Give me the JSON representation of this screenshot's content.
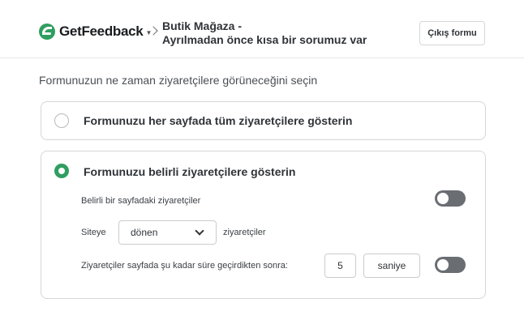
{
  "header": {
    "logo_text": "GetFeedback",
    "logo_caret": "▼",
    "breadcrumb_title": "Butik Mağaza -",
    "breadcrumb_subtitle": "Ayrılmadan önce kısa bir sorumuz var",
    "exit_button_label": "Çıkış formu"
  },
  "main": {
    "section_title": "Formunuzun ne zaman ziyaretçilere görüneceğini seçin",
    "option_all": {
      "label": "Formunuzu her sayfada tüm ziyaretçilere gösterin",
      "selected": false
    },
    "option_specific": {
      "label": "Formunuzu belirli ziyaretçilere gösterin",
      "selected": true,
      "page_visitors_label": "Belirli bir sayfadaki ziyaretçiler",
      "page_visitors_toggle": false,
      "site_prefix": "Siteye",
      "site_select_value": "dönen",
      "site_suffix": "ziyaretçiler",
      "time_label": "Ziyaretçiler sayfada şu kadar süre geçirdikten sonra:",
      "time_value": "5",
      "time_unit": "saniye",
      "time_toggle": false
    }
  },
  "colors": {
    "brand_green": "#2f9e5f",
    "toggle_off": "#6a6e73",
    "border": "#d4d6d8"
  }
}
